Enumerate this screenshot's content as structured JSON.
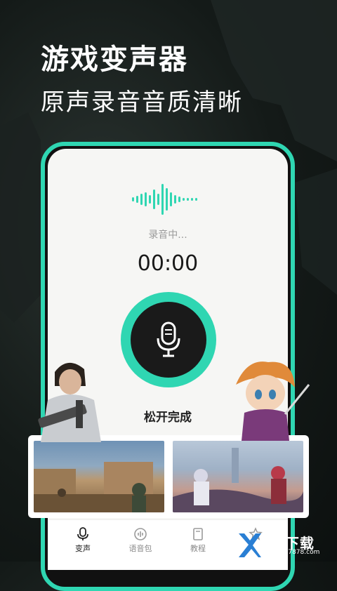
{
  "headline": "游戏变声器",
  "subline": "原声录音音质清晰",
  "recorder": {
    "status": "录音中...",
    "timer": "00:00",
    "hold_hint": "松开完成"
  },
  "tabs": [
    {
      "label": "变声",
      "icon": "mic-icon",
      "active": true
    },
    {
      "label": "语音包",
      "icon": "voice-pack-icon",
      "active": false
    },
    {
      "label": "教程",
      "icon": "book-icon",
      "active": false
    },
    {
      "label": "",
      "icon": "star-icon",
      "active": false
    }
  ],
  "watermark": {
    "brand": "78下载",
    "url": "4007787878.com"
  },
  "colors": {
    "accent": "#2fd6b2",
    "dark": "#1a1a1a",
    "screen": "#f6f6f4"
  }
}
